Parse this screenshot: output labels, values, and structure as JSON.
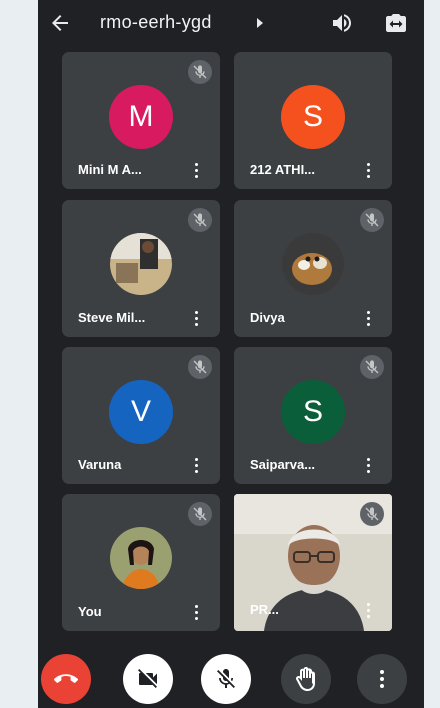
{
  "meeting": {
    "code": "rmo-eerh-ygd",
    "icons": {
      "back": "arrow-left-icon",
      "expand": "caret-right-icon",
      "audio": "speaker-icon",
      "camera_switch": "switch-camera-icon"
    }
  },
  "participants": [
    {
      "name": "Mini M A...",
      "initial": "M",
      "color": "#d81b60",
      "muted": true
    },
    {
      "name": "212 ATHI...",
      "initial": "S",
      "color": "#f4511e",
      "muted": false
    },
    {
      "name": "Steve Mil...",
      "initial": "",
      "avatar": "photo",
      "muted": true
    },
    {
      "name": "Divya",
      "initial": "",
      "avatar": "photo",
      "muted": true
    },
    {
      "name": "Varuna",
      "initial": "V",
      "color": "#1565c0",
      "muted": true
    },
    {
      "name": "Saiparva...",
      "initial": "S",
      "color": "#0b5e3a",
      "muted": true
    },
    {
      "name": "You",
      "initial": "",
      "avatar": "photo",
      "muted": true
    },
    {
      "name": "PR...",
      "initial": "",
      "avatar": "video",
      "muted": true
    }
  ],
  "controls": [
    {
      "name": "leave-call",
      "icon": "end-call-icon",
      "color": "#ea4335"
    },
    {
      "name": "camera-off",
      "icon": "video-off-icon",
      "color": "#ffffff"
    },
    {
      "name": "mic-off",
      "icon": "mic-off-icon",
      "color": "#ffffff"
    },
    {
      "name": "raise-hand",
      "icon": "hand-icon",
      "color": "#3c4043"
    },
    {
      "name": "more",
      "icon": "more-vert-icon",
      "color": "#3c4043"
    }
  ]
}
